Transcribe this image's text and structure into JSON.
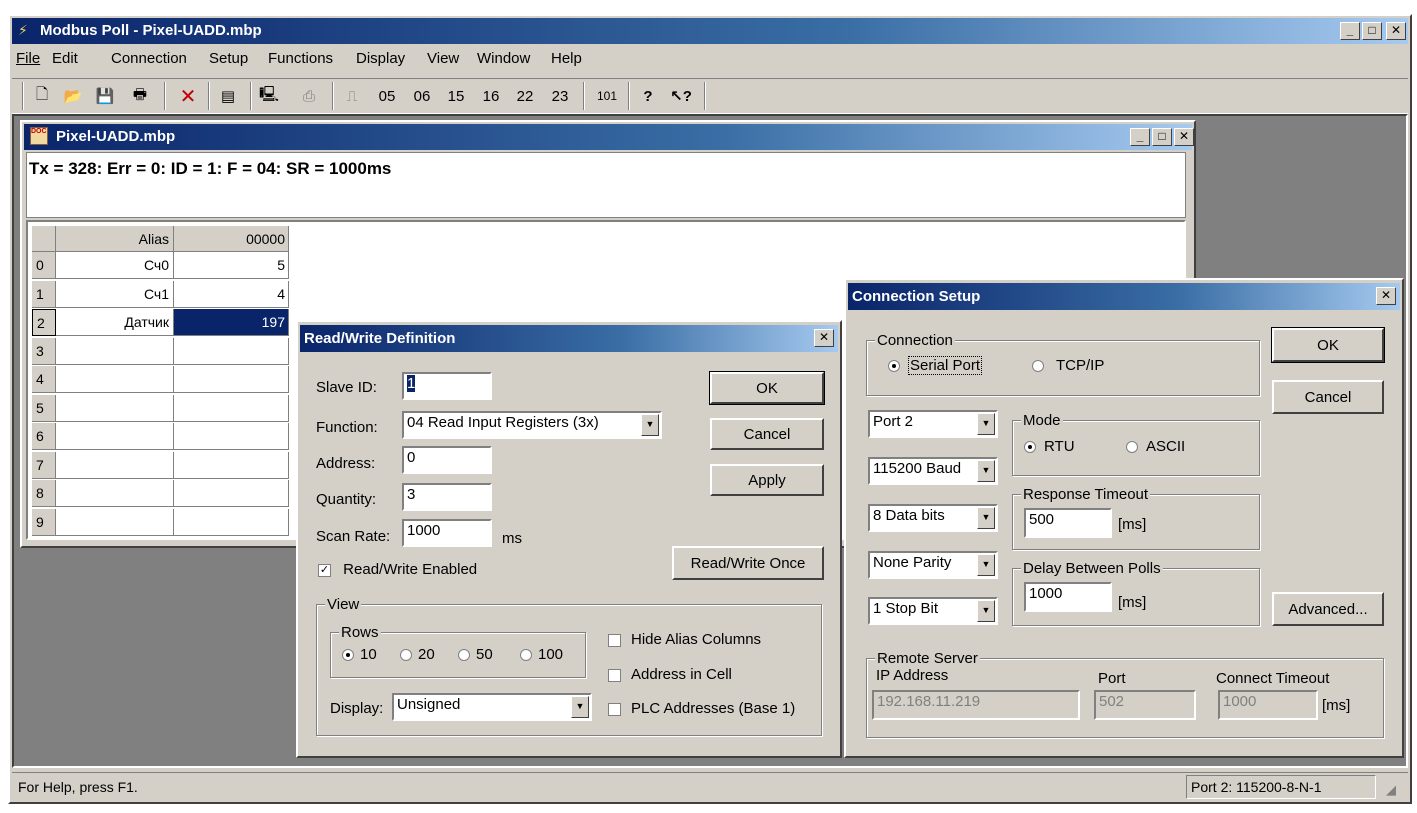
{
  "app": {
    "title": "Modbus Poll - Pixel-UADD.mbp",
    "menu": [
      "File",
      "Edit",
      "Connection",
      "Setup",
      "Functions",
      "Display",
      "View",
      "Window",
      "Help"
    ],
    "toolbar_fn_codes": [
      "05",
      "06",
      "15",
      "16",
      "22",
      "23"
    ],
    "toolbar_101": "101",
    "status_left": "For Help, press F1.",
    "status_right": "Port 2: 115200-8-N-1"
  },
  "doc": {
    "title": "Pixel-UADD.mbp",
    "status_line": "Tx = 328: Err = 0: ID = 1: F = 04: SR = 1000ms",
    "headers": [
      "Alias",
      "00000"
    ],
    "rows": [
      {
        "idx": "0",
        "alias": "Сч0",
        "value": "5"
      },
      {
        "idx": "1",
        "alias": "Сч1",
        "value": "4"
      },
      {
        "idx": "2",
        "alias": "Датчик",
        "value": "197"
      },
      {
        "idx": "3",
        "alias": "",
        "value": ""
      },
      {
        "idx": "4",
        "alias": "",
        "value": ""
      },
      {
        "idx": "5",
        "alias": "",
        "value": ""
      },
      {
        "idx": "6",
        "alias": "",
        "value": ""
      },
      {
        "idx": "7",
        "alias": "",
        "value": ""
      },
      {
        "idx": "8",
        "alias": "",
        "value": ""
      },
      {
        "idx": "9",
        "alias": "",
        "value": ""
      }
    ]
  },
  "rw": {
    "title": "Read/Write Definition",
    "slave_label": "Slave ID:",
    "slave_value": "1",
    "function_label": "Function:",
    "function_value": "04 Read Input Registers (3x)",
    "address_label": "Address:",
    "address_value": "0",
    "quantity_label": "Quantity:",
    "quantity_value": "3",
    "scan_label": "Scan Rate:",
    "scan_value": "1000",
    "scan_unit": "ms",
    "enabled_label": "Read/Write Enabled",
    "ok": "OK",
    "cancel": "Cancel",
    "apply": "Apply",
    "once": "Read/Write Once",
    "view_legend": "View",
    "rows_legend": "Rows",
    "rows_options": [
      "10",
      "20",
      "50",
      "100"
    ],
    "hide_alias": "Hide Alias Columns",
    "addr_in_cell": "Address in Cell",
    "plc_addr": "PLC Addresses (Base 1)",
    "display_label": "Display:",
    "display_value": "Unsigned"
  },
  "cs": {
    "title": "Connection Setup",
    "connection_legend": "Connection",
    "serial": "Serial Port",
    "tcp": "TCP/IP",
    "ok": "OK",
    "cancel": "Cancel",
    "advanced": "Advanced...",
    "port": "Port 2",
    "baud": "115200 Baud",
    "databits": "8 Data bits",
    "parity": "None Parity",
    "stopbit": "1 Stop Bit",
    "mode_legend": "Mode",
    "rtu": "RTU",
    "ascii": "ASCII",
    "timeout_legend": "Response Timeout",
    "timeout_value": "500",
    "ms": "[ms]",
    "delay_legend": "Delay Between Polls",
    "delay_value": "1000",
    "remote_legend": "Remote Server",
    "ip_label": "IP Address",
    "ip_value": "192.168.11.219",
    "port_label": "Port",
    "port_value": "502",
    "ct_label": "Connect Timeout",
    "ct_value": "1000"
  }
}
